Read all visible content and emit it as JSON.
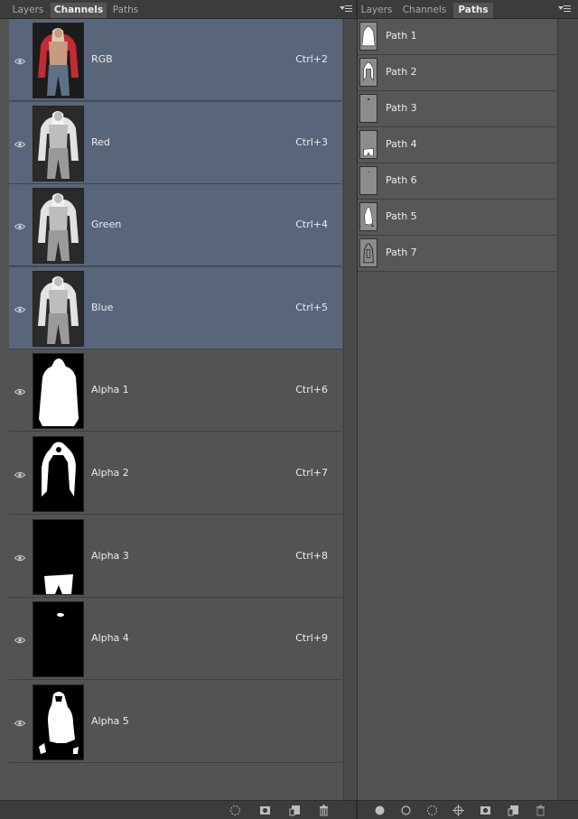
{
  "channels_panel": {
    "tabs": [
      {
        "label": "Layers",
        "active": false
      },
      {
        "label": "Channels",
        "active": true
      },
      {
        "label": "Paths",
        "active": false
      }
    ],
    "channels": [
      {
        "name": "RGB",
        "shortcut": "Ctrl+2",
        "selected": true,
        "visible": true,
        "thumb": "color-photo"
      },
      {
        "name": "Red",
        "shortcut": "Ctrl+3",
        "selected": true,
        "visible": true,
        "thumb": "gray-photo"
      },
      {
        "name": "Green",
        "shortcut": "Ctrl+4",
        "selected": true,
        "visible": true,
        "thumb": "gray-photo"
      },
      {
        "name": "Blue",
        "shortcut": "Ctrl+5",
        "selected": true,
        "visible": true,
        "thumb": "gray-photo"
      },
      {
        "name": "Alpha 1",
        "shortcut": "Ctrl+6",
        "selected": false,
        "visible": true,
        "thumb": "mask-body"
      },
      {
        "name": "Alpha 2",
        "shortcut": "Ctrl+7",
        "selected": false,
        "visible": true,
        "thumb": "mask-hair"
      },
      {
        "name": "Alpha 3",
        "shortcut": "Ctrl+8",
        "selected": false,
        "visible": true,
        "thumb": "mask-shorts"
      },
      {
        "name": "Alpha 4",
        "shortcut": "Ctrl+9",
        "selected": false,
        "visible": true,
        "thumb": "mask-dot"
      },
      {
        "name": "Alpha 5",
        "shortcut": "",
        "selected": false,
        "visible": true,
        "thumb": "mask-figure"
      }
    ],
    "bottom_icons": [
      "load-selection-icon",
      "save-selection-icon",
      "new-channel-icon",
      "delete-channel-icon"
    ]
  },
  "paths_panel": {
    "tabs": [
      {
        "label": "Layers",
        "active": false
      },
      {
        "label": "Channels",
        "active": false
      },
      {
        "label": "Paths",
        "active": true
      }
    ],
    "paths": [
      {
        "name": "Path 1",
        "thumb": "body"
      },
      {
        "name": "Path 2",
        "thumb": "hair"
      },
      {
        "name": "Path 3",
        "thumb": "dot"
      },
      {
        "name": "Path 4",
        "thumb": "shorts"
      },
      {
        "name": "Path 6",
        "thumb": "dot-small"
      },
      {
        "name": "Path 5",
        "thumb": "figure"
      },
      {
        "name": "Path 7",
        "thumb": "outline"
      }
    ],
    "bottom_icons": [
      "fill-path-icon",
      "stroke-path-icon",
      "load-path-as-selection-icon",
      "make-work-path-icon",
      "add-mask-icon",
      "new-path-icon",
      "delete-path-icon"
    ]
  },
  "colors": {
    "panel_bg": "#535353",
    "selected_row": "#596579",
    "tabbar_bg": "#3c3c3c"
  }
}
